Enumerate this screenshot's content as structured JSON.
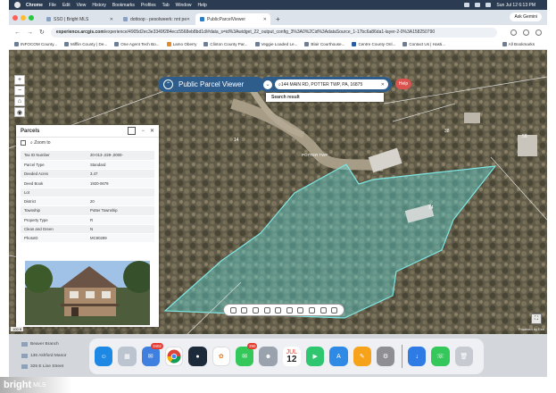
{
  "menubar": {
    "app": "Chrome",
    "items": [
      "File",
      "Edit",
      "View",
      "History",
      "Bookmarks",
      "Profiles",
      "Tab",
      "Window",
      "Help"
    ],
    "datetime": "Sun Jul 12  6:13 PM"
  },
  "tabs": [
    {
      "label": "SSO | Bright MLS",
      "active": false
    },
    {
      "label": "dottoop - pesolweerk: nnt pe",
      "active": false
    },
    {
      "label": "PublicParcelViewer",
      "active": true
    }
  ],
  "ask_gemini": "Ask Gemini",
  "address": {
    "host": "experience.arcgis.com",
    "path": "/experience/4905d2ec3e3349f284ecc5568eb8bd1d/#data_s=id%3Awidget_22_output_config_3%3A0%2Cid%3AdataSource_1-17bc6a86da1-layer-2-0%3A158250790"
  },
  "bookmarks": [
    "INFOCOM County...",
    "Mifflin County | De...",
    "One Agent Tech Bo...",
    "Lamo Oberry",
    "Clinton County Par...",
    "Veggie Loaded Le...",
    "Blair Courthouse...",
    "Centre County Onl...",
    "Contact Us | Hasti..."
  ],
  "all_bookmarks": "All Bookmarks",
  "viewer": {
    "title": "Public Parcel Viewer",
    "search_value": "144 MAIN RD, POTTER TWP, PA, 16875",
    "help": "Help",
    "search_result": "Search result"
  },
  "map_labels": {
    "road": "POTTER TWP",
    "parcel_a": "14",
    "parcel_b": "38",
    "parcel_c": "58",
    "parcel_d": "14"
  },
  "panel": {
    "title": "Parcels",
    "zoom_to": "Zoom to",
    "attributes": [
      {
        "key": "Tax ID Number",
        "value": "20-013-,029-,0000-"
      },
      {
        "key": "Parcel Type",
        "value": "Standard"
      },
      {
        "key": "Deeded Acres",
        "value": "3.47"
      },
      {
        "key": "Deed Book",
        "value": "1920-0679"
      },
      {
        "key": "Lot",
        "value": ""
      },
      {
        "key": "District",
        "value": "20"
      },
      {
        "key": "Township",
        "value": "Potter Township"
      },
      {
        "key": "Property Type",
        "value": "R"
      },
      {
        "key": "Clean and Green",
        "value": "N"
      },
      {
        "key": "PhotoID",
        "value": "MC80289"
      }
    ]
  },
  "map_footer": {
    "scale": "100 ft",
    "powered": "Powered by Esri"
  },
  "listings": [
    "Beaver Branch",
    "136 Ashford Manor",
    "325 E Line Street"
  ],
  "dock": {
    "mail_badge": "3402",
    "messages_badge": "290",
    "calendar_month": "JUL",
    "calendar_day": "12"
  },
  "watermark": {
    "brand": "bright",
    "suffix": "MLS"
  },
  "colors": {
    "parcel_fill": "#5fd3d0",
    "viewer_bar": "#2e5d8c",
    "help": "#d9534f"
  }
}
